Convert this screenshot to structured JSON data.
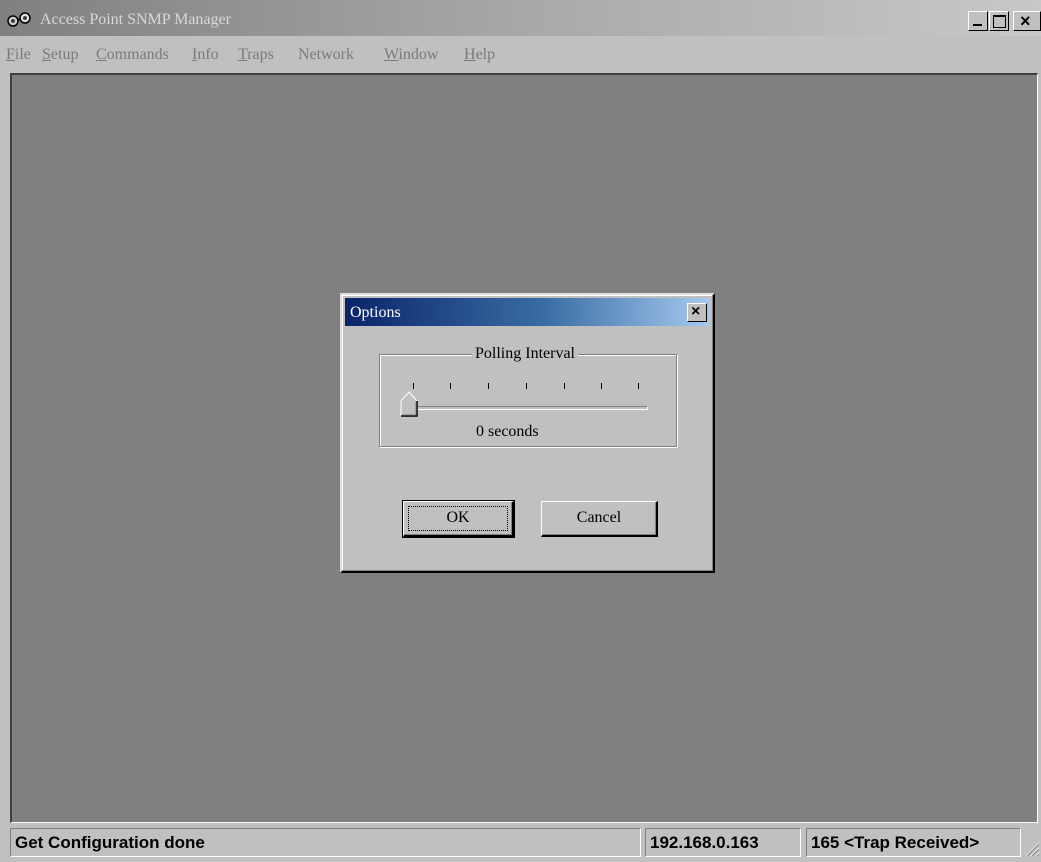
{
  "window": {
    "title": "Access Point SNMP Manager",
    "close_glyph": "×"
  },
  "menu": [
    {
      "label": "File",
      "accel": "F",
      "rest": "ile"
    },
    {
      "label": "Setup",
      "accel": "S",
      "rest": "etup"
    },
    {
      "label": "Commands",
      "accel": "C",
      "rest": "ommands"
    },
    {
      "label": "Info",
      "accel": "I",
      "rest": "nfo"
    },
    {
      "label": "Traps",
      "accel": "T",
      "rest": "raps"
    },
    {
      "label": "Network",
      "accel": "",
      "rest": "Network"
    },
    {
      "label": "Window",
      "accel": "W",
      "rest": "indow"
    },
    {
      "label": "Help",
      "accel": "H",
      "rest": "elp"
    }
  ],
  "dialog": {
    "title": "Options",
    "close_glyph": "×",
    "group_label": "Polling Interval",
    "slider": {
      "value_text": "0 seconds",
      "position": 0,
      "tick_count": 7
    },
    "ok_label": "OK",
    "cancel_label": "Cancel"
  },
  "status": {
    "message": "Get Configuration done",
    "ip": "192.168.0.163",
    "traps": "165 <Trap Received>"
  },
  "colors": {
    "desktop": "#808080",
    "face": "#c0c0c0",
    "dialog_title_start": "#0a246a",
    "dialog_title_end": "#a6caf0"
  },
  "icons": {
    "app": "network-nodes-icon",
    "minimize": "minimize-icon",
    "maximize": "maximize-icon",
    "close": "close-icon",
    "size_grip": "size-grip-icon"
  }
}
